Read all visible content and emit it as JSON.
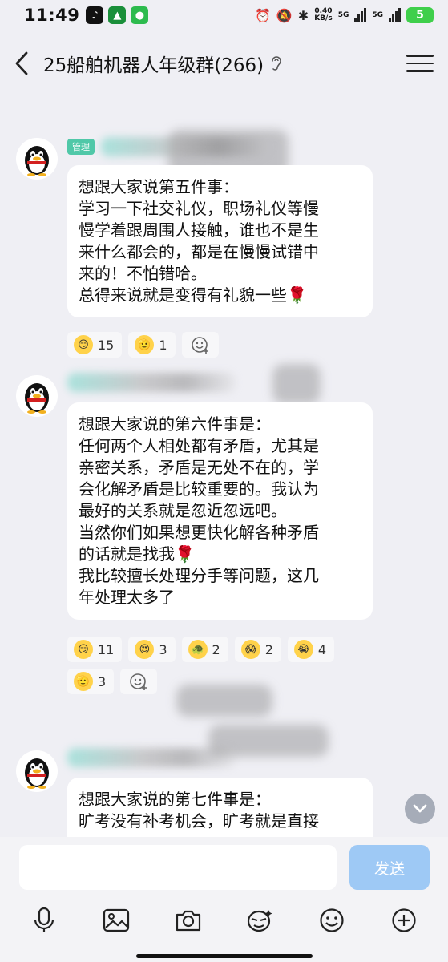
{
  "status_bar": {
    "time": "11:49",
    "net_speed": "0.40\nKB/s",
    "sim1": "5G",
    "sim2": "5G",
    "battery": "5"
  },
  "header": {
    "title": "25船舶机器人年级群(266)"
  },
  "messages": [
    {
      "sender_badge": "管理",
      "lines": [
        "想跟大家说第五件事：",
        "学习一下社交礼仪，职场礼仪等慢",
        "慢学着跟周围人接触，谁也不是生",
        "来什么都会的，都是在慢慢试错中",
        "来的！不怕错哈。",
        "总得来说就是变得有礼貌一些"
      ],
      "reactions": [
        {
          "emoji": "😏",
          "count": "15"
        },
        {
          "emoji": "🫡",
          "count": "1"
        }
      ]
    },
    {
      "lines": [
        "想跟大家说的第六件事是：",
        "任何两个人相处都有矛盾，尤其是",
        "亲密关系，矛盾是无处不在的，学",
        "会化解矛盾是比较重要的。我认为",
        "最好的关系就是忽近忽远吧。",
        "当然你们如果想更快化解各种矛盾",
        "的话就是找我",
        "我比较擅长处理分手等问题，这几",
        "年处理太多了"
      ],
      "reactions": [
        {
          "emoji": "😏",
          "count": "11"
        },
        {
          "emoji": "😍",
          "count": "3"
        },
        {
          "emoji": "🐢",
          "count": "2"
        },
        {
          "emoji": "😱",
          "count": "2"
        },
        {
          "emoji": "😭",
          "count": "4"
        },
        {
          "emoji": "🫡",
          "count": "3"
        }
      ]
    },
    {
      "lines": [
        "想跟大家说的第七件事是：",
        "旷考没有补考机会，旷考就是直接"
      ]
    }
  ],
  "input": {
    "placeholder": "",
    "send_label": "发送"
  },
  "toolbar": [
    "microphone-icon",
    "image-icon",
    "camera-icon",
    "sticker-icon",
    "emoji-icon",
    "plus-icon"
  ],
  "colors": {
    "background": "#efeff4",
    "bubble": "#ffffff",
    "send_button": "#9ec9f5",
    "admin_badge": "#50c8a8"
  }
}
